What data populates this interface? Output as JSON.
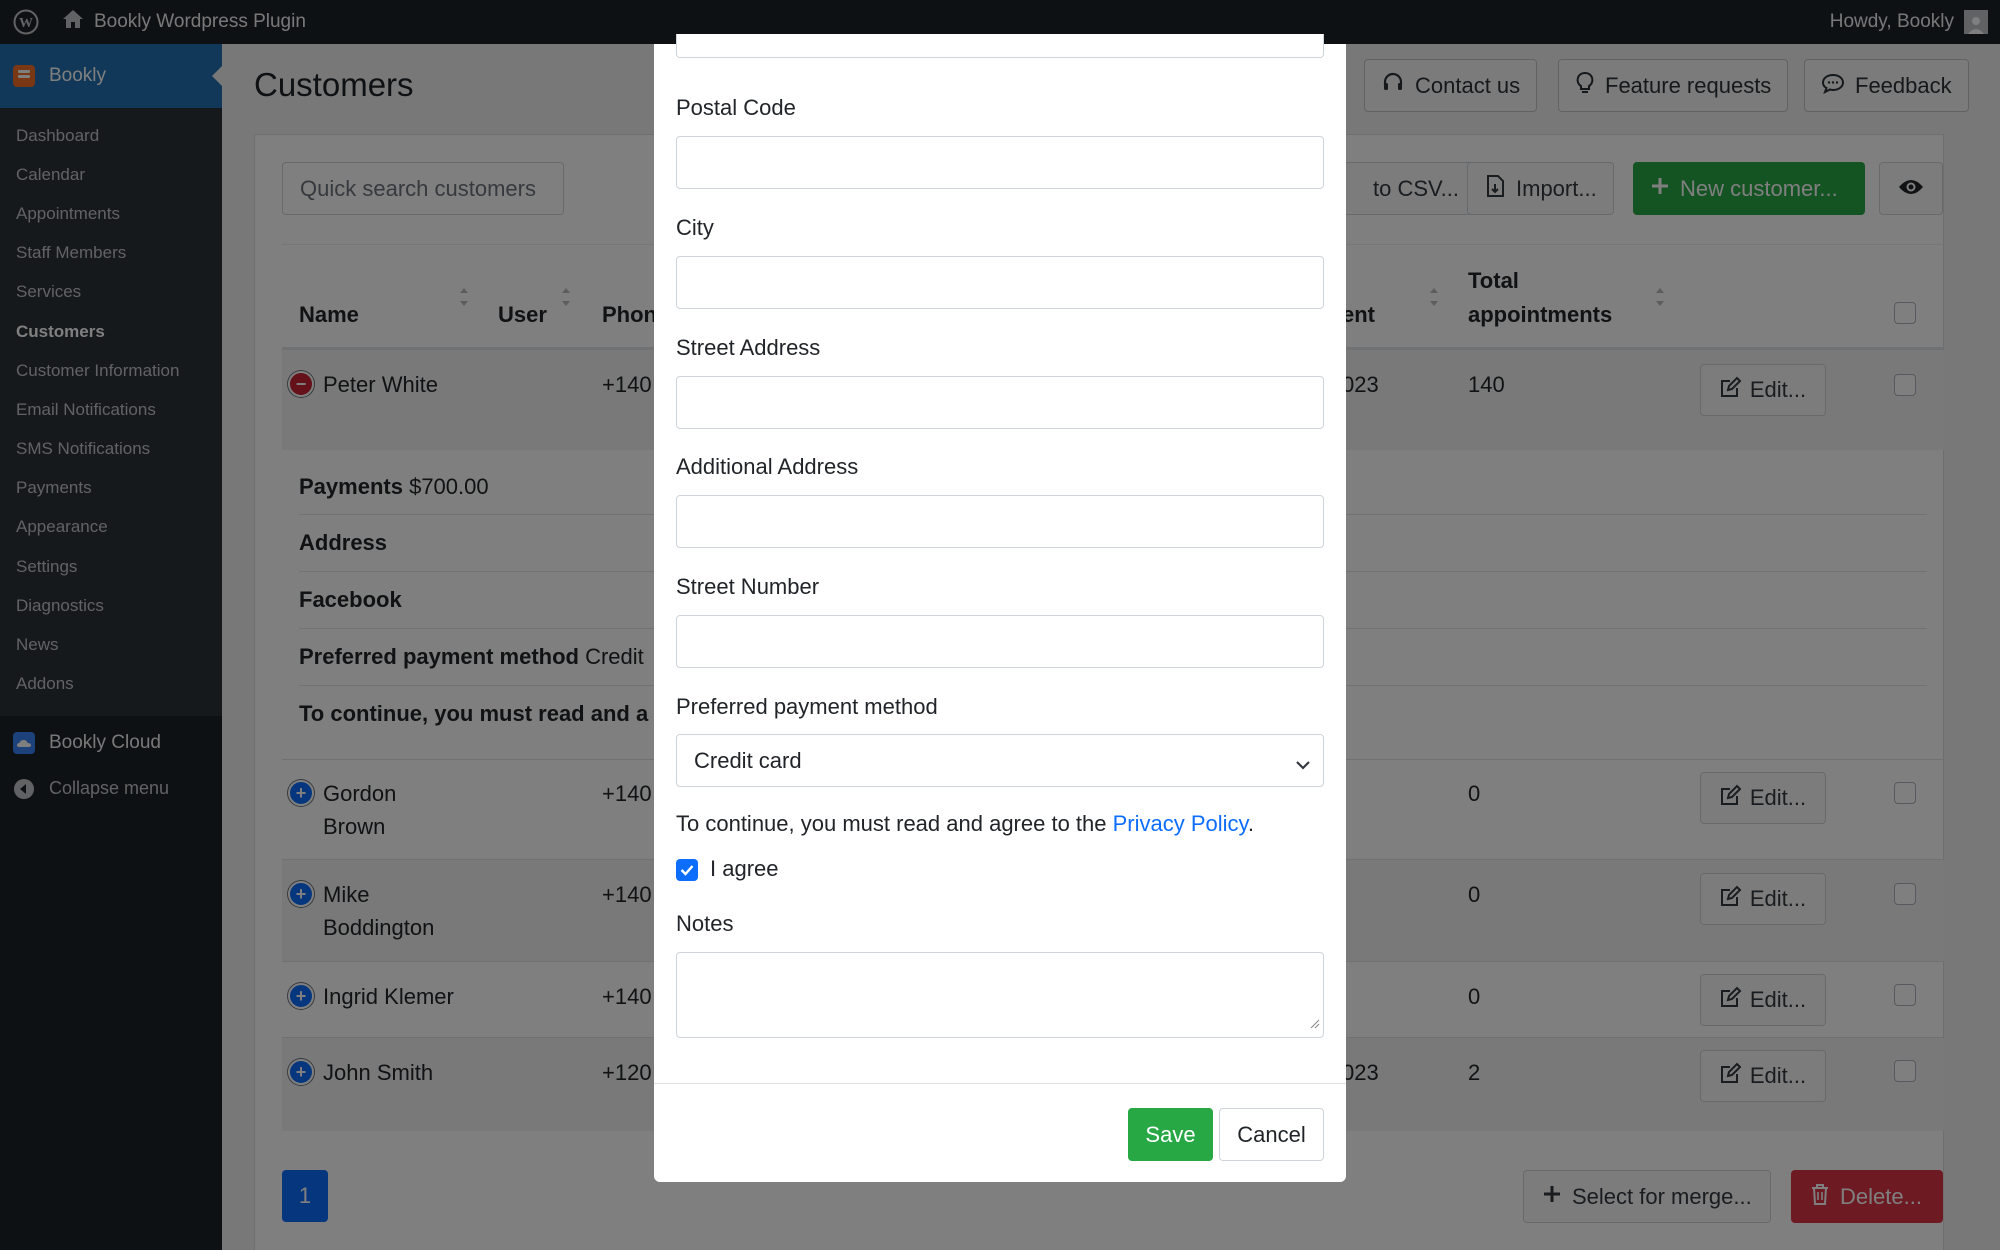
{
  "adminbar": {
    "site_name": "Bookly Wordpress Plugin",
    "howdy": "Howdy, Bookly"
  },
  "sidebar": {
    "top_item": "Bookly",
    "items": [
      {
        "label": "Dashboard"
      },
      {
        "label": "Calendar"
      },
      {
        "label": "Appointments"
      },
      {
        "label": "Staff Members"
      },
      {
        "label": "Services"
      },
      {
        "label": "Customers"
      },
      {
        "label": "Customer Information"
      },
      {
        "label": "Email Notifications"
      },
      {
        "label": "SMS Notifications"
      },
      {
        "label": "Payments"
      },
      {
        "label": "Appearance"
      },
      {
        "label": "Settings"
      },
      {
        "label": "Diagnostics"
      },
      {
        "label": "News"
      },
      {
        "label": "Addons"
      }
    ],
    "cloud": "Bookly Cloud",
    "collapse": "Collapse menu"
  },
  "page": {
    "title": "Customers",
    "contact_us": "Contact us",
    "feature_requests": "Feature requests",
    "feedback": "Feedback"
  },
  "toolbar": {
    "search_placeholder": "Quick search customers",
    "export": "to CSV...",
    "import": "Import...",
    "new_customer": "New customer..."
  },
  "table": {
    "headers": {
      "name": "Name",
      "user": "User",
      "phone": "Phon",
      "last_appointment": "ent",
      "total_line1": "Total",
      "total_line2": "appointments"
    },
    "rows": [
      {
        "name": "Peter White",
        "name2": "",
        "phone": "+140",
        "last": "023",
        "total": "140",
        "edit": "Edit..."
      },
      {
        "name": "Gordon",
        "name2": "Brown",
        "phone": "+140",
        "last": "",
        "total": "0",
        "edit": "Edit..."
      },
      {
        "name": "Mike",
        "name2": "Boddington",
        "phone": "+140",
        "last": "",
        "total": "0",
        "edit": "Edit..."
      },
      {
        "name": "Ingrid Klemer",
        "name2": "",
        "phone": "+140",
        "last": "",
        "total": "0",
        "edit": "Edit..."
      },
      {
        "name": "John Smith",
        "name2": "",
        "phone": "+120",
        "last": "023",
        "total": "2",
        "edit": "Edit..."
      }
    ],
    "details": {
      "payments_label": "Payments",
      "payments_value": "$700.00",
      "address_label": "Address",
      "facebook_label": "Facebook",
      "payment_method_label": "Preferred payment method",
      "payment_method_value": "Credit",
      "agree_text": "To continue, you must read and a"
    }
  },
  "pagination": {
    "current": "1"
  },
  "bottom": {
    "merge": "Select for merge...",
    "delete": "Delete..."
  },
  "modal": {
    "postal_code": "Postal Code",
    "city": "City",
    "street_address": "Street Address",
    "additional_address": "Additional Address",
    "street_number": "Street Number",
    "payment_method_label": "Preferred payment method",
    "payment_method_value": "Credit card",
    "privacy_prefix": "To continue, you must read and agree to the ",
    "privacy_link": "Privacy Policy",
    "privacy_suffix": ".",
    "agree": "I agree",
    "notes": "Notes",
    "save": "Save",
    "cancel": "Cancel"
  },
  "colors": {
    "admin_dark": "#1d2327",
    "wp_blue": "#2271b1",
    "bootstrap_green": "#28a745",
    "bootstrap_blue": "#0d6efd",
    "bootstrap_red": "#dc3545"
  }
}
